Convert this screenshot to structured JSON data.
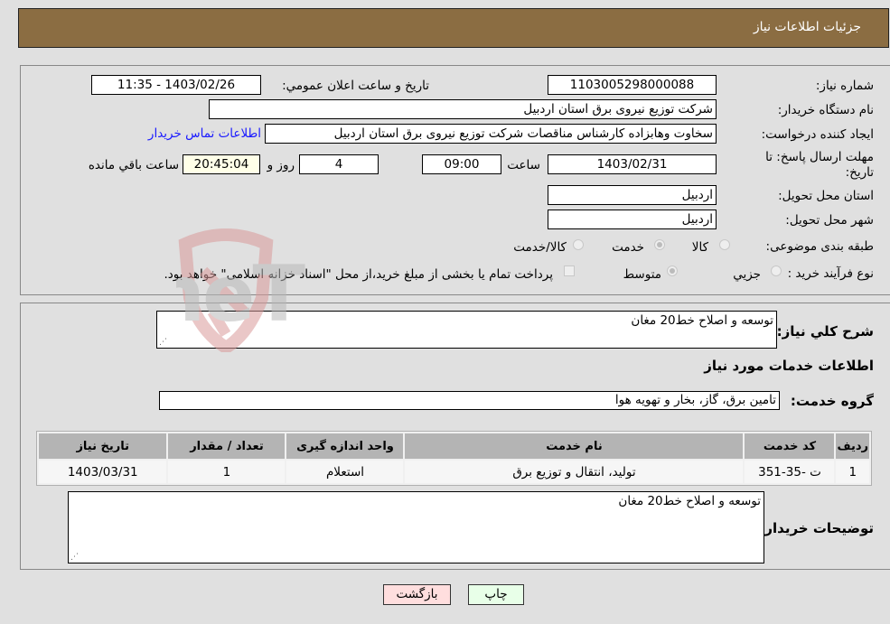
{
  "header": {
    "title": "جزئیات اطلاعات نیاز"
  },
  "form": {
    "need_number_label": "شماره نیاز:",
    "need_number": "1103005298000088",
    "announce_label": "تاریخ و ساعت اعلان عمومي:",
    "announce_value": "1403/02/26 - 11:35",
    "buyer_org_label": "نام دستگاه خریدار:",
    "buyer_org": "شرکت توزیع نیروی برق استان اردبیل",
    "creator_label": "ایجاد کننده درخواست:",
    "creator": "سخاوت وهابزاده کارشناس مناقصات شرکت توزیع نیروی برق استان اردبیل",
    "contact_link": "اطلاعات تماس خریدار",
    "deadline_label": "مهلت ارسال پاسخ: تا تاریخ:",
    "deadline_date": "1403/02/31",
    "time_label": "ساعت",
    "deadline_time": "09:00",
    "days_value": "4",
    "days_label": "روز و",
    "remaining_time": "20:45:04",
    "remaining_label": "ساعت باقي مانده",
    "province_label": "استان محل تحویل:",
    "province": "اردبیل",
    "city_label": "شهر محل تحویل:",
    "city": "اردبیل",
    "category_label": "طبقه بندی موضوعی:",
    "category_options": [
      {
        "label": "کالا",
        "checked": false
      },
      {
        "label": "خدمت",
        "checked": true
      },
      {
        "label": "کالا/خدمت",
        "checked": false
      }
    ],
    "process_label": "نوع فرآیند خرید :",
    "process_options": [
      {
        "label": "جزيي",
        "checked": false
      },
      {
        "label": "متوسط",
        "checked": true
      }
    ],
    "treasury_note": "پرداخت تمام یا بخشی از مبلغ خرید،از محل \"اسناد خزانه اسلامی\" خواهد بود.",
    "treasury_checked": false
  },
  "details": {
    "summary_label": "شرح کلي نیاز:",
    "summary": "توسعه و اصلاح خط20 مغان",
    "services_heading": "اطلاعات خدمات مورد نیاز",
    "service_group_label": "گروه خدمت:",
    "service_group": "تامین برق، گاز، بخار و تهویه هوا",
    "table": {
      "headers": [
        "ردیف",
        "کد خدمت",
        "نام خدمت",
        "واحد اندازه گیری",
        "تعداد / مقدار",
        "تاریخ نیاز"
      ],
      "rows": [
        [
          "1",
          "ت -35-351",
          "تولید، انتقال و توزیع برق",
          "استعلام",
          "1",
          "1403/03/31"
        ]
      ]
    },
    "buyer_notes_label": "توضیحات خریدار:",
    "buyer_notes": "توسعه و اصلاح خط20 مغان"
  },
  "buttons": {
    "print": "چاپ",
    "back": "بازگشت"
  },
  "watermark": {
    "text": "AriaTender.neT"
  },
  "colors": {
    "header_bg": "#8b6d42",
    "print_bg": "#e8ffe8",
    "back_bg": "#ffdede",
    "link": "#1a1aff"
  }
}
